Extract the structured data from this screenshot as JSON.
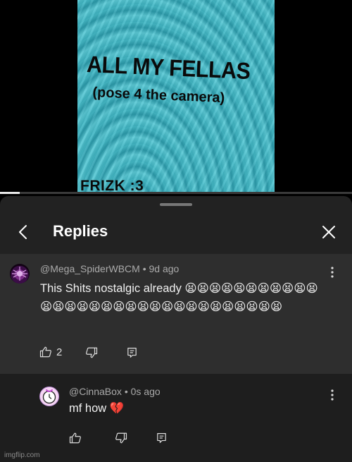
{
  "video": {
    "meme_title": "ALL MY FELLAS",
    "meme_subtitle": "(pose 4 the camera)",
    "meme_credit": "FRIZK :3",
    "progress_fraction": 0.055
  },
  "panel": {
    "title": "Replies"
  },
  "parent_comment": {
    "author": "@Mega_SpiderWBCM",
    "time": "9d ago",
    "text": "This Shits nostalgic already 😫😫😫😫😫😫😫😫😫😫😫😫😫😫😫😫😫😫😫😫😫😫😫😫😫😫😫😫😫😫😫",
    "likes": "2"
  },
  "reply": {
    "author": "@CinnaBox",
    "time": "0s ago",
    "text": "mf how 💔"
  },
  "watermark": "imgflip.com",
  "icons": {
    "back": "chevron-left-icon",
    "close": "close-icon",
    "like": "thumbs-up-icon",
    "dislike": "thumbs-down-icon",
    "reply": "reply-icon",
    "more": "more-vertical-icon"
  }
}
